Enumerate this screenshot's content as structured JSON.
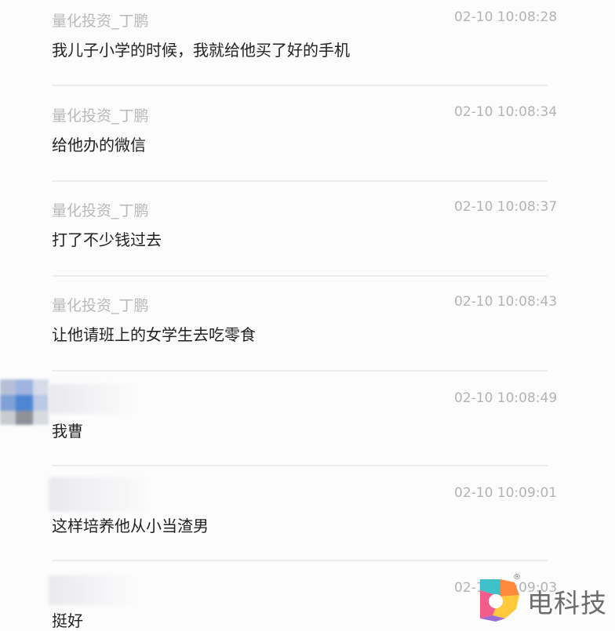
{
  "messages": [
    {
      "sender": "量化投资_丁鹏",
      "time": "02-10 10:08:28",
      "text": "我儿子小学的时候，我就给他买了好的手机"
    },
    {
      "sender": "量化投资_丁鹏",
      "time": "02-10 10:08:34",
      "text": "给他办的微信"
    },
    {
      "sender": "量化投资_丁鹏",
      "time": "02-10 10:08:37",
      "text": "打了不少钱过去"
    },
    {
      "sender": "量化投资_丁鹏",
      "time": "02-10 10:08:43",
      "text": "让他请班上的女学生去吃零食"
    },
    {
      "sender": "",
      "time": "02-10 10:08:49",
      "text": "我曹"
    },
    {
      "sender": "",
      "time": "02-10 10:09:01",
      "text": "这样培养他从小当渣男"
    },
    {
      "sender": "",
      "time": "02-10 10:09:03",
      "text": "挺好"
    }
  ],
  "watermark": {
    "text": "电科技",
    "reg": "®"
  },
  "colors": {
    "sender": "#b9b9b9",
    "time": "#b3b3b3",
    "text": "#222222",
    "divider": "#ececec"
  }
}
